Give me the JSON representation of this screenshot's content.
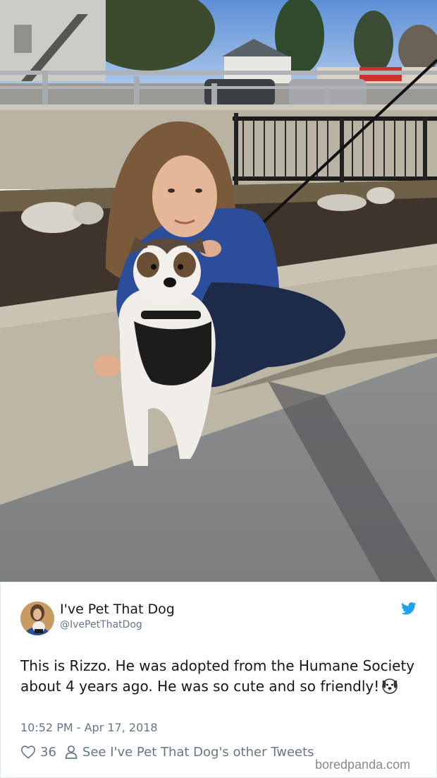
{
  "photo": {
    "description_icon": "photo-girl-with-dog",
    "sign_text": "",
    "store_sign": ""
  },
  "tweet": {
    "display_name": "I've Pet That Dog",
    "handle": "@IvePetThatDog",
    "text": "This is Rizzo. He was adopted from the Humane Society about 4 years ago. He was so cute and so friendly!",
    "emoji_icon": "dog-face-icon",
    "timestamp": "10:52 PM - Apr 17, 2018",
    "likes": "36",
    "other_tweets_link": "See I've Pet That Dog's other Tweets",
    "brand_icon": "twitter-bird-icon",
    "brand_color": "#1da1f2"
  },
  "watermark": "boredpanda.com"
}
